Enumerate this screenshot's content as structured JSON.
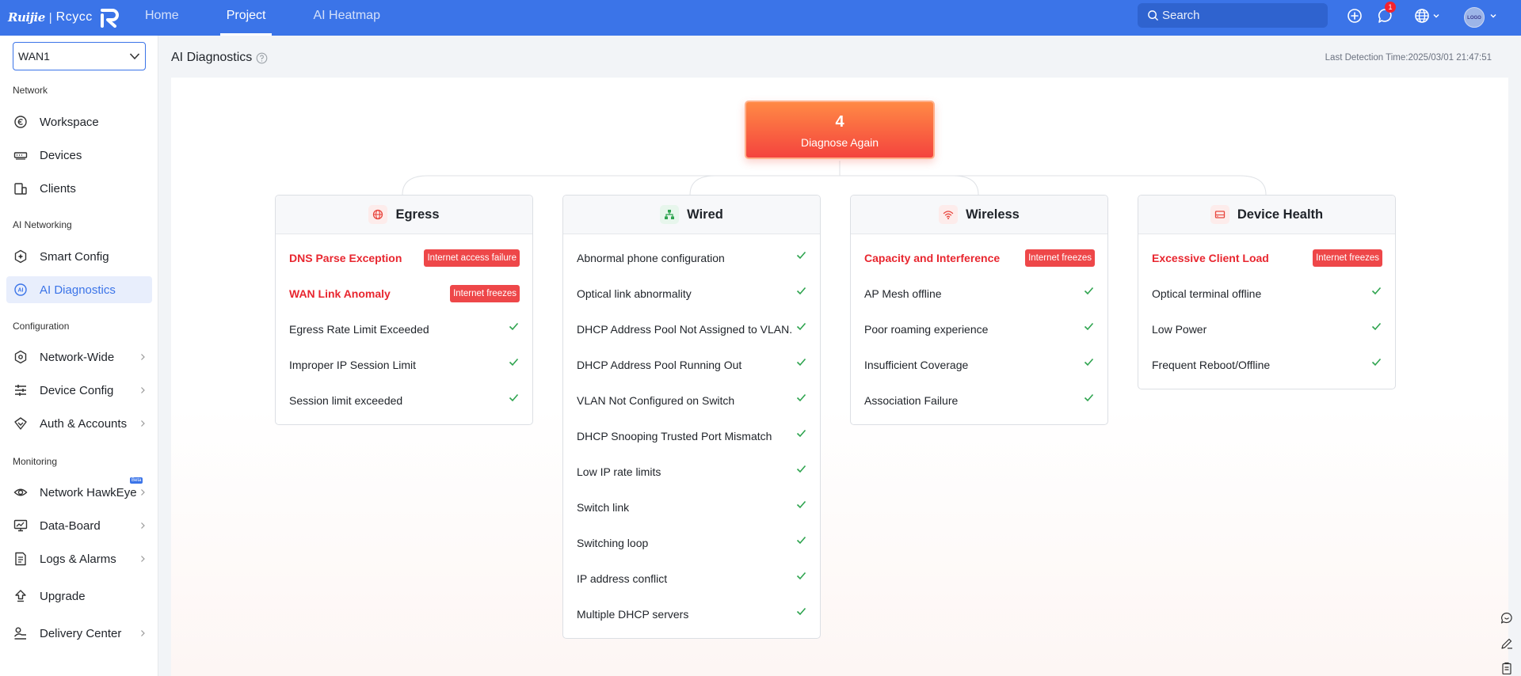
{
  "brand": {
    "name": "Ruijie",
    "product": "Rcycc"
  },
  "nav": [
    {
      "label": "Home",
      "active": false
    },
    {
      "label": "Project",
      "active": true
    },
    {
      "label": "AI Heatmap",
      "active": false
    }
  ],
  "search": {
    "placeholder": "Search"
  },
  "notifications": {
    "count": "1"
  },
  "avatar": {
    "text": "LOGO"
  },
  "sidebar": {
    "wan": {
      "value": "WAN1"
    },
    "sections": {
      "network": "Network",
      "ai": "AI Networking",
      "config": "Configuration",
      "monitoring": "Monitoring"
    },
    "items": {
      "workspace": "Workspace",
      "devices": "Devices",
      "clients": "Clients",
      "smart_config": "Smart Config",
      "ai_diagnostics": "AI Diagnostics",
      "network_wide": "Network-Wide",
      "device_config": "Device Config",
      "auth_accounts": "Auth & Accounts",
      "hawkeye": "Network HawkEye",
      "hawkeye_badge": "Beta",
      "data_board": "Data-Board",
      "logs_alarms": "Logs & Alarms",
      "upgrade": "Upgrade",
      "delivery_center": "Delivery Center"
    }
  },
  "main": {
    "title": "AI Diagnostics",
    "last_detection": "Last Detection Time:2025/03/01 21:47:51",
    "diagnose": {
      "count": "4",
      "label": "Diagnose Again"
    }
  },
  "colors": {
    "primary": "#3b74e8",
    "fault": "#e8262f",
    "ok": "#2ea44f",
    "button_top": "#ff8a45",
    "button_bottom": "#f4443e"
  },
  "cards": {
    "egress": {
      "title": "Egress",
      "icon": "globe-icon",
      "rows": [
        {
          "label": "DNS Parse Exception",
          "status": "fault",
          "tag": "Internet access failure"
        },
        {
          "label": "WAN Link Anomaly",
          "status": "fault",
          "tag": "Internet freezes"
        },
        {
          "label": "Egress Rate Limit Exceeded",
          "status": "ok",
          "tag": ""
        },
        {
          "label": "Improper IP Session Limit",
          "status": "ok",
          "tag": ""
        },
        {
          "label": "Session limit exceeded",
          "status": "ok",
          "tag": ""
        }
      ]
    },
    "wired": {
      "title": "Wired",
      "icon": "topology-icon",
      "rows": [
        {
          "label": "Abnormal phone configuration",
          "status": "ok",
          "tag": ""
        },
        {
          "label": "Optical link abnormality",
          "status": "ok",
          "tag": ""
        },
        {
          "label": "DHCP Address Pool Not Assigned to VLAN.",
          "status": "ok",
          "tag": ""
        },
        {
          "label": "DHCP Address Pool Running Out",
          "status": "ok",
          "tag": ""
        },
        {
          "label": "VLAN Not Configured on Switch",
          "status": "ok",
          "tag": ""
        },
        {
          "label": "DHCP Snooping Trusted Port Mismatch",
          "status": "ok",
          "tag": ""
        },
        {
          "label": "Low IP rate limits",
          "status": "ok",
          "tag": ""
        },
        {
          "label": "Switch link",
          "status": "ok",
          "tag": ""
        },
        {
          "label": "Switching loop",
          "status": "ok",
          "tag": ""
        },
        {
          "label": "IP address conflict",
          "status": "ok",
          "tag": ""
        },
        {
          "label": "Multiple DHCP servers",
          "status": "ok",
          "tag": ""
        }
      ]
    },
    "wireless": {
      "title": "Wireless",
      "icon": "wifi-icon",
      "rows": [
        {
          "label": "Capacity and Interference",
          "status": "fault",
          "tag": "Internet freezes"
        },
        {
          "label": "AP Mesh offline",
          "status": "ok",
          "tag": ""
        },
        {
          "label": "Poor roaming experience",
          "status": "ok",
          "tag": ""
        },
        {
          "label": "Insufficient Coverage",
          "status": "ok",
          "tag": ""
        },
        {
          "label": "Association Failure",
          "status": "ok",
          "tag": ""
        }
      ]
    },
    "device_health": {
      "title": "Device Health",
      "icon": "router-icon",
      "rows": [
        {
          "label": "Excessive Client Load",
          "status": "fault",
          "tag": "Internet freezes"
        },
        {
          "label": "Optical terminal offline",
          "status": "ok",
          "tag": ""
        },
        {
          "label": "Low Power",
          "status": "ok",
          "tag": ""
        },
        {
          "label": "Frequent Reboot/Offline",
          "status": "ok",
          "tag": ""
        }
      ]
    }
  }
}
